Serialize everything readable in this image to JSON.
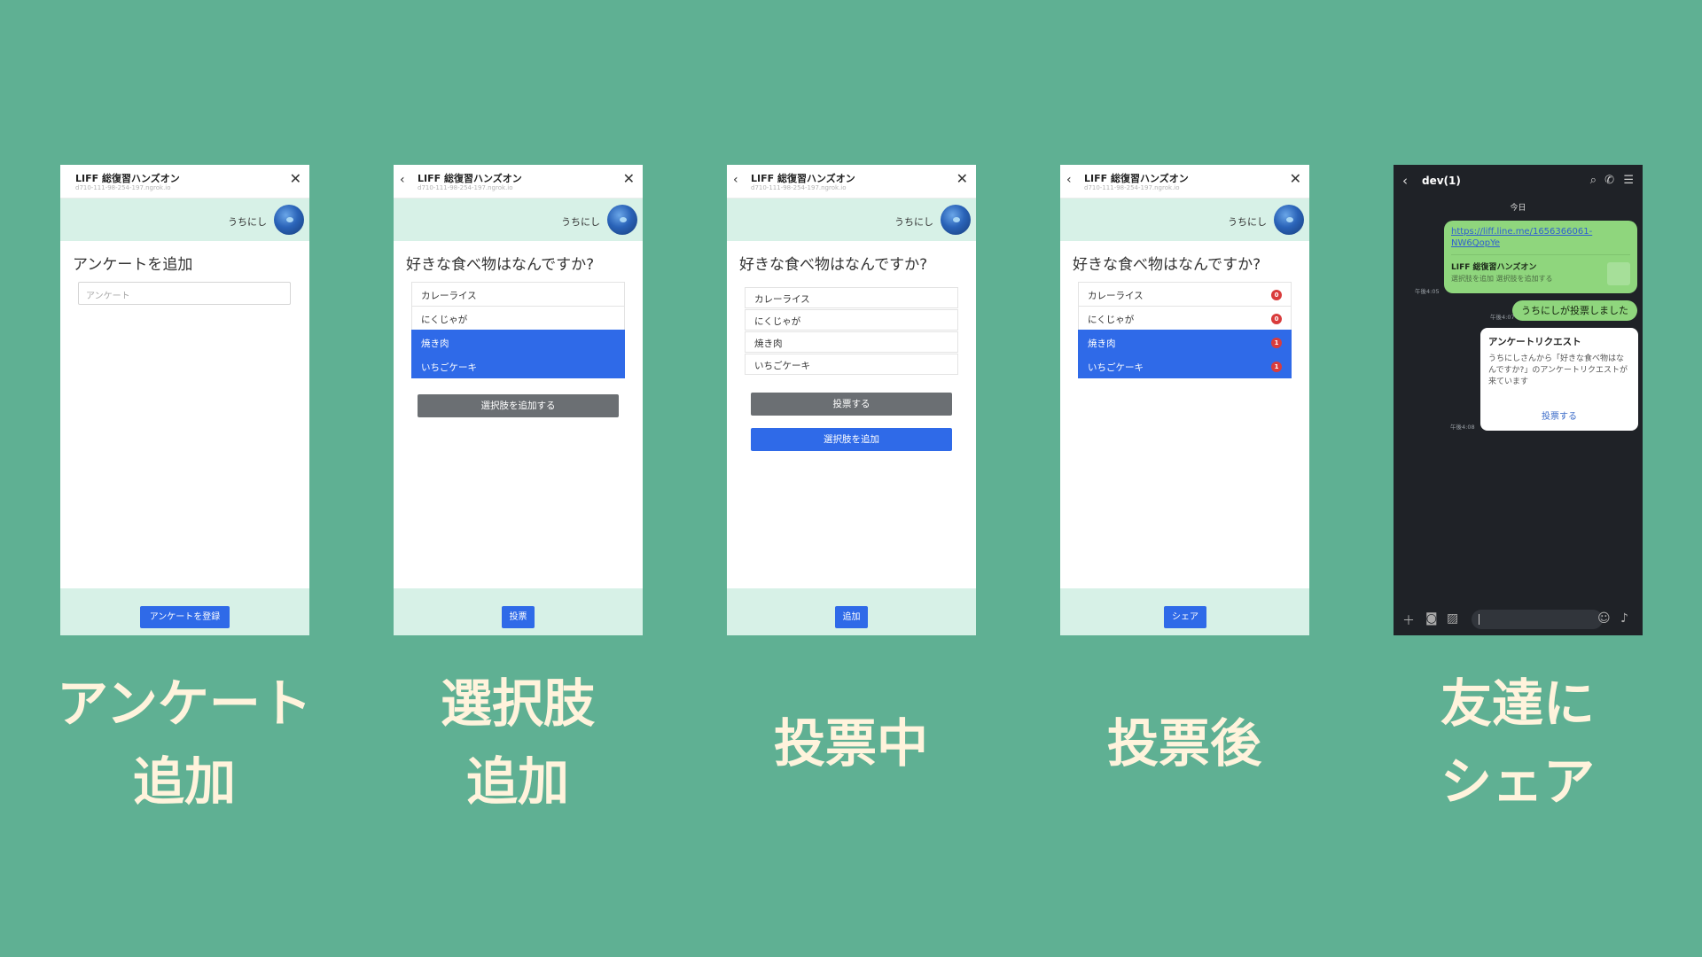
{
  "app": {
    "title": "LIFF 総復習ハンズオン",
    "url": "d710-111-98-254-197.ngrok.io",
    "username": "うちにし"
  },
  "screens": [
    {
      "heading": "アンケートを追加",
      "input_placeholder": "アンケート",
      "footer_button": "アンケートを登録"
    },
    {
      "heading": "好きな食べ物はなんですか?",
      "options": [
        "カレーライス",
        "にくじゃが",
        "焼き肉",
        "いちごケーキ"
      ],
      "add_option_button": "選択肢を追加する",
      "footer_button": "投票"
    },
    {
      "heading": "好きな食べ物はなんですか?",
      "options": [
        "カレーライス",
        "にくじゃが",
        "焼き肉",
        "いちごケーキ"
      ],
      "vote_button": "投票する",
      "add_option_button": "選択肢を追加",
      "footer_button": "追加"
    },
    {
      "heading": "好きな食べ物はなんですか?",
      "options": [
        "カレーライス",
        "にくじゃが",
        "焼き肉",
        "いちごケーキ"
      ],
      "vote_counts": [
        "0",
        "0",
        "1",
        "1"
      ],
      "footer_button": "シェア"
    }
  ],
  "chat": {
    "room_name": "dev(1)",
    "date_label": "今日",
    "link_url": "https://liff.line.me/1656366061-NW6QopYe",
    "link_card_title": "LIFF 総復習ハンズオン",
    "link_card_desc": "選択肢を追加 選択肢を追加する",
    "time_1": "午後4:05",
    "vote_message": "うちにしが投票しました",
    "time_2": "午後4:07",
    "request_title": "アンケートリクエスト",
    "request_body": "うちにしさんから「好きな食べ物はなんですか?」のアンケートリクエストが来ています",
    "request_link": "投票する",
    "time_3": "午後4:08"
  },
  "captions": [
    [
      "アンケート",
      "追加"
    ],
    [
      "選択肢",
      "追加"
    ],
    [
      "投票中"
    ],
    [
      "投票後"
    ],
    [
      "友達に",
      "シェア"
    ]
  ],
  "colors": {
    "background": "#5fb093",
    "primary_blue": "#2f6ae8",
    "mint": "#d7f1e7",
    "badge_red": "#d93c3c",
    "caption": "#fff3dc"
  }
}
